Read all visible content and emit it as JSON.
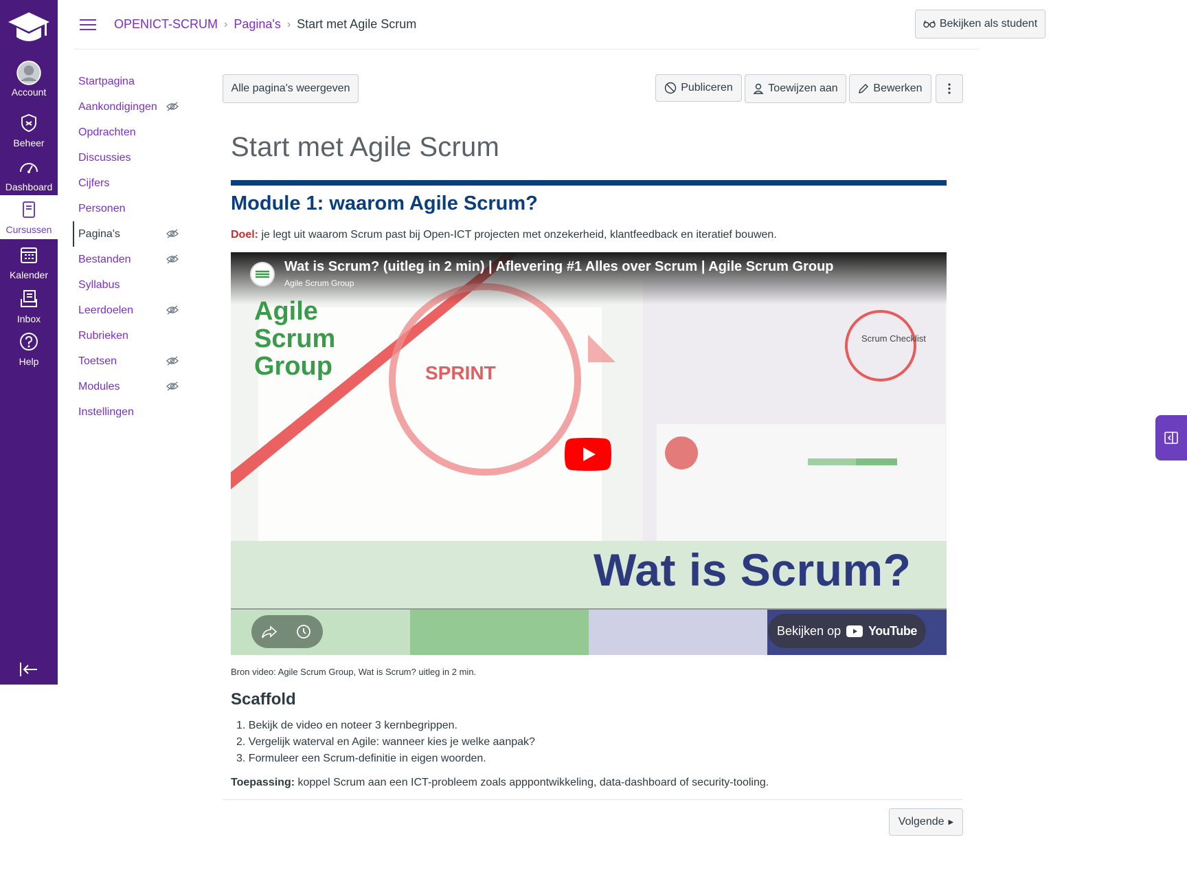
{
  "global_nav": {
    "items": [
      {
        "label": "Account",
        "icon": "account-icon"
      },
      {
        "label": "Beheer",
        "icon": "shield-icon"
      },
      {
        "label": "Dashboard",
        "icon": "dashboard-icon"
      },
      {
        "label": "Cursussen",
        "icon": "book-icon"
      },
      {
        "label": "Kalender",
        "icon": "calendar-icon"
      },
      {
        "label": "Inbox",
        "icon": "inbox-icon"
      },
      {
        "label": "Help",
        "icon": "help-icon"
      }
    ]
  },
  "breadcrumb": {
    "course": "OPENICT-SCRUM",
    "section": "Pagina's",
    "current": "Start met Agile Scrum"
  },
  "header": {
    "student_view": "Bekijken als student"
  },
  "course_nav": {
    "items": [
      {
        "label": "Startpagina",
        "hidden": false
      },
      {
        "label": "Aankondigingen",
        "hidden": true
      },
      {
        "label": "Opdrachten",
        "hidden": false
      },
      {
        "label": "Discussies",
        "hidden": false
      },
      {
        "label": "Cijfers",
        "hidden": false
      },
      {
        "label": "Personen",
        "hidden": false
      },
      {
        "label": "Pagina's",
        "hidden": true
      },
      {
        "label": "Bestanden",
        "hidden": true
      },
      {
        "label": "Syllabus",
        "hidden": false
      },
      {
        "label": "Leerdoelen",
        "hidden": true
      },
      {
        "label": "Rubrieken",
        "hidden": false
      },
      {
        "label": "Toetsen",
        "hidden": true
      },
      {
        "label": "Modules",
        "hidden": true
      },
      {
        "label": "Instellingen",
        "hidden": false
      }
    ],
    "active": "Pagina's"
  },
  "toolbar": {
    "all_pages": "Alle pagina's weergeven",
    "publish": "Publiceren",
    "assign": "Toewijzen aan",
    "edit": "Bewerken"
  },
  "page": {
    "title": "Start met Agile Scrum",
    "module_heading": "Module 1: waarom Agile Scrum?",
    "goal_label": "Doel:",
    "goal_text": "je legt uit waarom Scrum past bij Open-ICT projecten met onzekerheid, klantfeedback en iteratief bouwen.",
    "video": {
      "title": "Wat is Scrum? (uitleg in 2 min) | Aflevering #1 Alles over Scrum | Agile Scrum Group",
      "channel": "Agile Scrum Group",
      "logo_text": "Agile Scrum Group",
      "sprint_text": "SPRINT",
      "checklist_text": "Scrum Checklist",
      "overlay_text": "Wat is Scrum?",
      "watch_on": "Bekijken op",
      "youtube": "YouTube"
    },
    "source": "Bron video: Agile Scrum Group, Wat is Scrum? uitleg in 2 min.",
    "scaffold_heading": "Scaffold",
    "steps": [
      "1. Bekijk de video en noteer 3 kernbegrippen.",
      "2. Vergelijk waterval en Agile: wanneer kies je welke aanpak?",
      "3. Formuleer een Scrum-definitie in eigen woorden."
    ],
    "application_label": "Toepassing:",
    "application_text": "koppel Scrum aan een ICT-probleem zoals apppontwikkeling, data-dashboard of security-tooling.",
    "next": "Volgende"
  },
  "colors": {
    "nav_bg": "#4a1a7c",
    "link": "#7b2fcb",
    "heading_blue": "#0a3e7c",
    "goal_red": "#c4312e"
  }
}
